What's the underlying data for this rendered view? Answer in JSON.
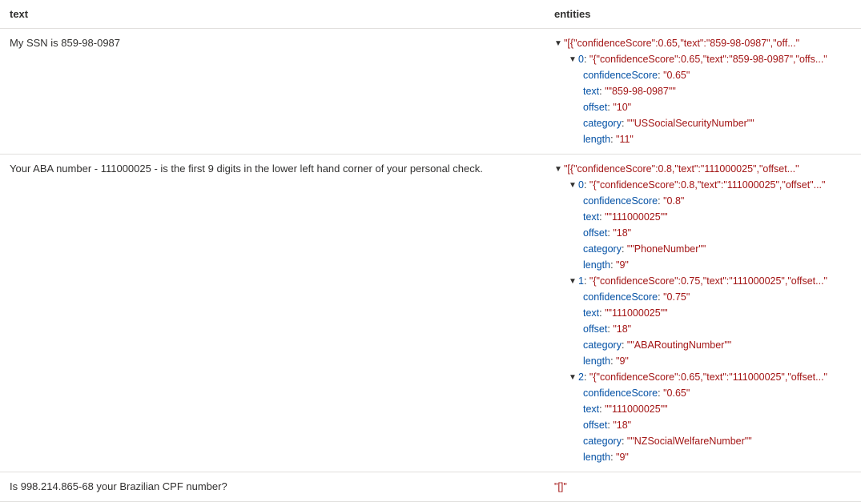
{
  "columns": {
    "text": "text",
    "entities": "entities"
  },
  "rows": [
    {
      "text": "My SSN is 859-98-0987",
      "rootSummary": "\"[{\"confidenceScore\":0.65,\"text\":\"859-98-0987\",\"off...\"",
      "items": [
        {
          "index": "0",
          "summary": "\"{\"confidenceScore\":0.65,\"text\":\"859-98-0987\",\"offs...\"",
          "props": [
            {
              "key": "confidenceScore",
              "value": "\"0.65\""
            },
            {
              "key": "text",
              "value": "\"\"859-98-0987\"\""
            },
            {
              "key": "offset",
              "value": "\"10\""
            },
            {
              "key": "category",
              "value": "\"\"USSocialSecurityNumber\"\""
            },
            {
              "key": "length",
              "value": "\"11\""
            }
          ]
        }
      ]
    },
    {
      "text": "Your ABA number - 111000025 - is the first 9 digits in the lower left hand corner of your personal check.",
      "rootSummary": "\"[{\"confidenceScore\":0.8,\"text\":\"111000025\",\"offset...\"",
      "items": [
        {
          "index": "0",
          "summary": "\"{\"confidenceScore\":0.8,\"text\":\"111000025\",\"offset\"...\"",
          "props": [
            {
              "key": "confidenceScore",
              "value": "\"0.8\""
            },
            {
              "key": "text",
              "value": "\"\"111000025\"\""
            },
            {
              "key": "offset",
              "value": "\"18\""
            },
            {
              "key": "category",
              "value": "\"\"PhoneNumber\"\""
            },
            {
              "key": "length",
              "value": "\"9\""
            }
          ]
        },
        {
          "index": "1",
          "summary": "\"{\"confidenceScore\":0.75,\"text\":\"111000025\",\"offset...\"",
          "props": [
            {
              "key": "confidenceScore",
              "value": "\"0.75\""
            },
            {
              "key": "text",
              "value": "\"\"111000025\"\""
            },
            {
              "key": "offset",
              "value": "\"18\""
            },
            {
              "key": "category",
              "value": "\"\"ABARoutingNumber\"\""
            },
            {
              "key": "length",
              "value": "\"9\""
            }
          ]
        },
        {
          "index": "2",
          "summary": "\"{\"confidenceScore\":0.65,\"text\":\"111000025\",\"offset...\"",
          "props": [
            {
              "key": "confidenceScore",
              "value": "\"0.65\""
            },
            {
              "key": "text",
              "value": "\"\"111000025\"\""
            },
            {
              "key": "offset",
              "value": "\"18\""
            },
            {
              "key": "category",
              "value": "\"\"NZSocialWelfareNumber\"\""
            },
            {
              "key": "length",
              "value": "\"9\""
            }
          ]
        }
      ]
    },
    {
      "text": "Is 998.214.865-68 your Brazilian CPF number?",
      "rootSummary": "\"[]\"",
      "items": []
    }
  ]
}
